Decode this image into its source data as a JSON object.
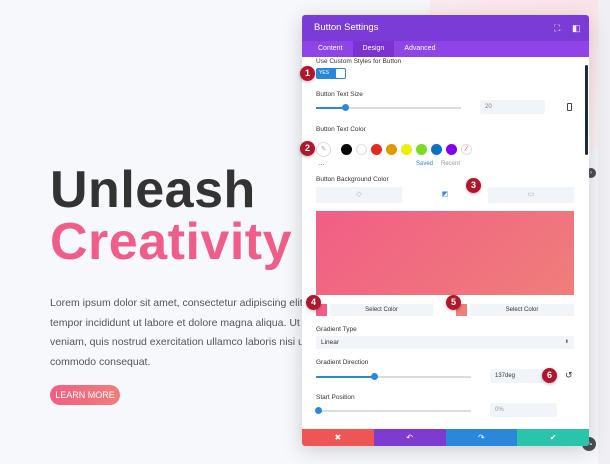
{
  "page": {
    "headline_line1": "Unleash",
    "headline_line2": "Creativity",
    "body_lines": [
      "Lorem ipsum dolor sit amet, consectetur adipiscing elit, se",
      "tempor incididunt ut labore et dolore magna aliqua. Ut en",
      "veniam, quis nostrud exercitation ullamco laboris nisi ut a",
      "commodo consequat."
    ],
    "cta_label": "LEARN MORE"
  },
  "modal": {
    "title": "Button Settings",
    "header_icons": [
      "expand-icon",
      "snap-icon"
    ],
    "tabs": [
      "Content",
      "Design",
      "Advanced"
    ],
    "active_tab": "Design",
    "custom_styles": {
      "label": "Use Custom Styles for Button",
      "toggle_text": "YES",
      "enabled": true
    },
    "text_size": {
      "label": "Button Text Size",
      "value": "20",
      "slider_fraction": 0.2
    },
    "text_color": {
      "label": "Button Text Color",
      "swatches": [
        "#000000",
        "#ffffff",
        "#e02b20",
        "#e09900",
        "#edf000",
        "#7cda24",
        "#0c71c3",
        "#8300e9"
      ],
      "saved_label": "Saved",
      "recent_label": "Recent",
      "more": "..."
    },
    "bg_color": {
      "label": "Button Background Color",
      "tabs": [
        "paint-bucket-icon",
        "gradient-icon",
        "image-icon"
      ],
      "active_tab": "gradient-icon",
      "gradient_start": "#f15e85",
      "gradient_end": "#f07e7a",
      "select_start_label": "Select Color",
      "select_end_label": "Select Color"
    },
    "gradient_type": {
      "label": "Gradient Type",
      "value": "Linear"
    },
    "gradient_direction": {
      "label": "Gradient Direction",
      "value": "137deg",
      "slider_fraction": 0.38
    },
    "start_position": {
      "label": "Start Position",
      "value": "0%",
      "slider_fraction": 0.0
    },
    "footer_buttons": [
      {
        "name": "cancel",
        "glyph": "✖",
        "color": "#ef5555"
      },
      {
        "name": "undo",
        "glyph": "↶",
        "color": "#7e3bd0"
      },
      {
        "name": "redo",
        "glyph": "↷",
        "color": "#2b87da"
      },
      {
        "name": "save",
        "glyph": "✔",
        "color": "#29c4a9"
      }
    ]
  },
  "annotations": [
    "1",
    "2",
    "3",
    "4",
    "5",
    "6"
  ]
}
